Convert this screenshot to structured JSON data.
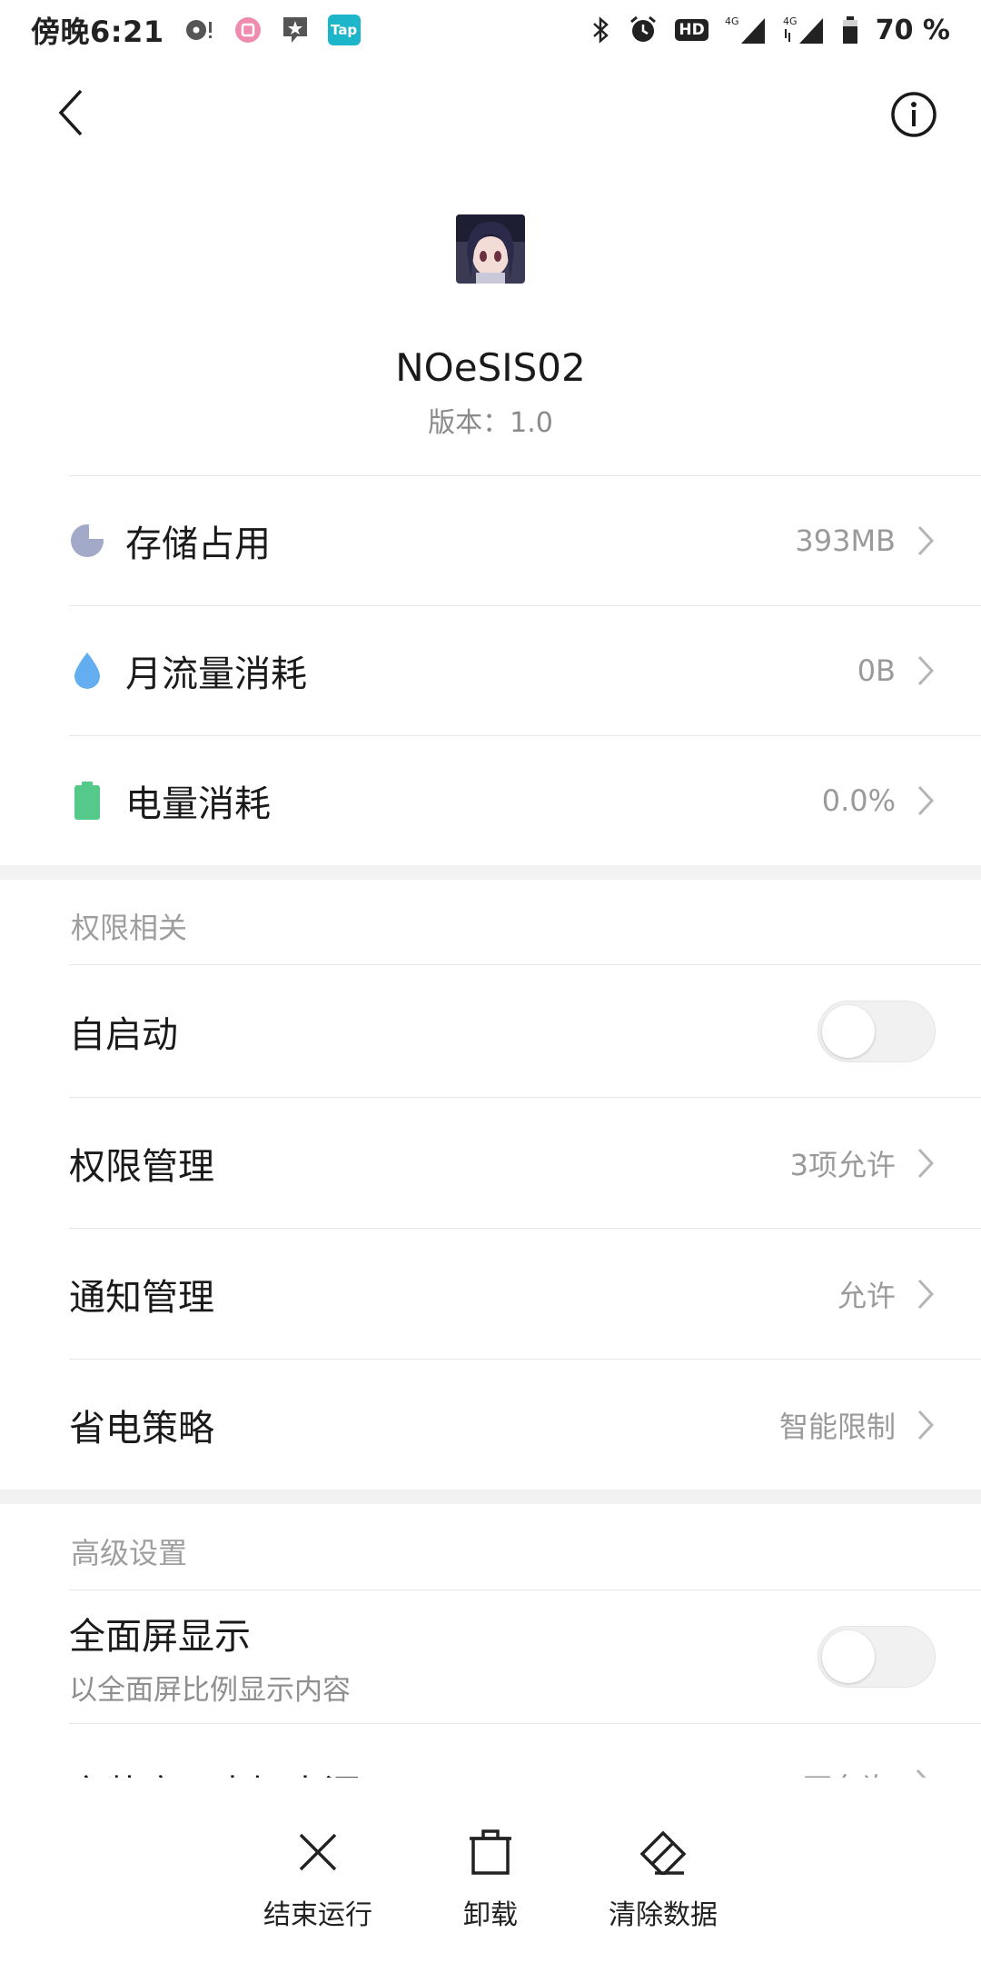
{
  "status_bar": {
    "time": "傍晚6:21",
    "battery_percent": "70 %",
    "network_left": "4G",
    "network_right": "4G",
    "hd_label": "HD",
    "tap_label": "Tap"
  },
  "app": {
    "name": "NOeSIS02",
    "version": "版本：1.0"
  },
  "usage": [
    {
      "title": "存储占用",
      "value": "393MB",
      "icon": "storage-pie-icon",
      "color": "#a3a9c9"
    },
    {
      "title": "月流量消耗",
      "value": "0B",
      "icon": "data-drop-icon",
      "color": "#62aef0"
    },
    {
      "title": "电量消耗",
      "value": "0.0%",
      "icon": "battery-icon",
      "color": "#55c98a"
    }
  ],
  "permissions_section": {
    "label": "权限相关",
    "autostart": {
      "title": "自启动",
      "enabled": false
    },
    "items": [
      {
        "title": "权限管理",
        "value": "3项允许"
      },
      {
        "title": "通知管理",
        "value": "允许"
      },
      {
        "title": "省电策略",
        "value": "智能限制"
      }
    ]
  },
  "advanced_section": {
    "label": "高级设置",
    "fullscreen": {
      "title": "全面屏显示",
      "subtitle": "以全面屏比例显示内容",
      "enabled": false
    },
    "install_source": {
      "title": "安装应用未知来源",
      "value": "不允许"
    }
  },
  "actions": {
    "force_stop": "结束运行",
    "uninstall": "卸载",
    "clear_data": "清除数据"
  }
}
